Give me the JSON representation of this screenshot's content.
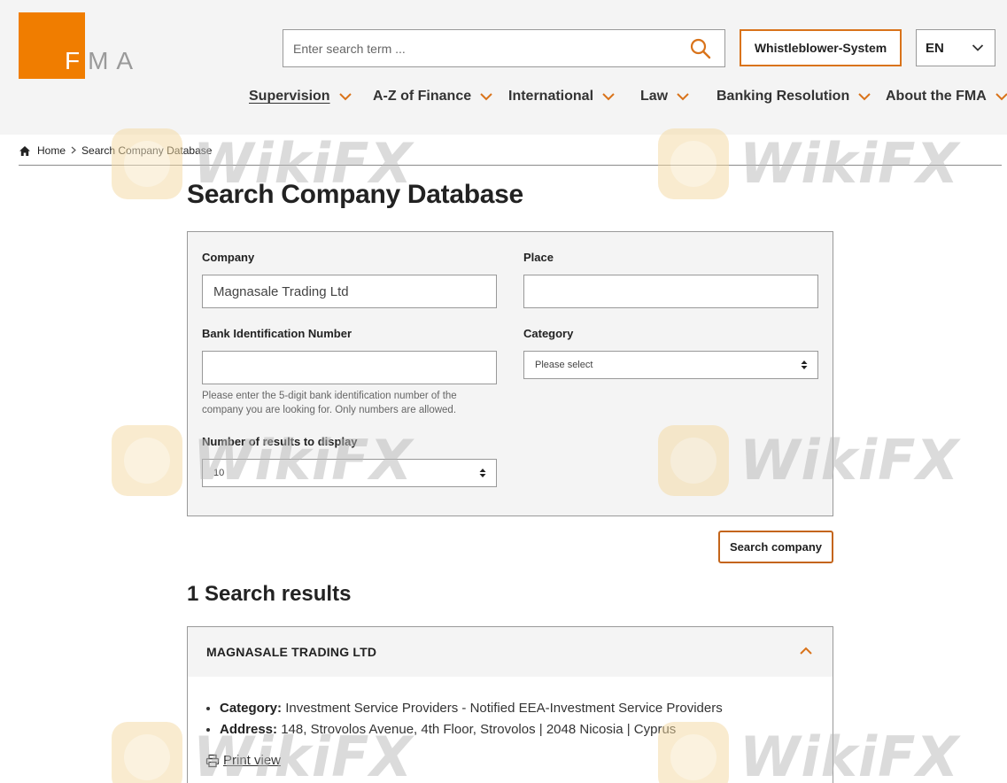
{
  "header": {
    "logo_text": "FMA",
    "search_placeholder": "Enter search term ...",
    "whistleblower_label": "Whistleblower-System",
    "language": "EN",
    "nav": [
      {
        "label": "Supervision"
      },
      {
        "label": "A-Z of Finance"
      },
      {
        "label": "International"
      },
      {
        "label": "Law"
      },
      {
        "label": "Banking Resolution"
      },
      {
        "label": "About the FMA"
      }
    ]
  },
  "breadcrumb": {
    "home": "Home",
    "current": "Search Company Database"
  },
  "page_title": "Search Company Database",
  "form": {
    "company_label": "Company",
    "company_value": "Magnasale Trading Ltd",
    "place_label": "Place",
    "place_value": "",
    "bin_label": "Bank Identification Number",
    "bin_value": "",
    "bin_hint": "Please enter the 5-digit bank identification number of the company you are looking for. Only numbers are allowed.",
    "category_label": "Category",
    "category_value": "Please select",
    "results_count_label": "Number of results to display",
    "results_count_value": "10",
    "submit_label": "Search company"
  },
  "results": {
    "title": "1 Search results",
    "items": [
      {
        "name": "MAGNASALE TRADING LTD",
        "category_label": "Category:",
        "category_value": "Investment Service Providers - Notified EEA-Investment Service Providers",
        "address_label": "Address:",
        "address_value": "148, Strovolos Avenue, 4th Floor, Strovolos |  2048  Nicosia  | Cyprus",
        "print_label": "Print view"
      }
    ]
  },
  "watermark": "WikiFX",
  "colors": {
    "accent": "#f07d00",
    "button_border": "#d9731a",
    "panel_bg": "#f4f4f4"
  }
}
